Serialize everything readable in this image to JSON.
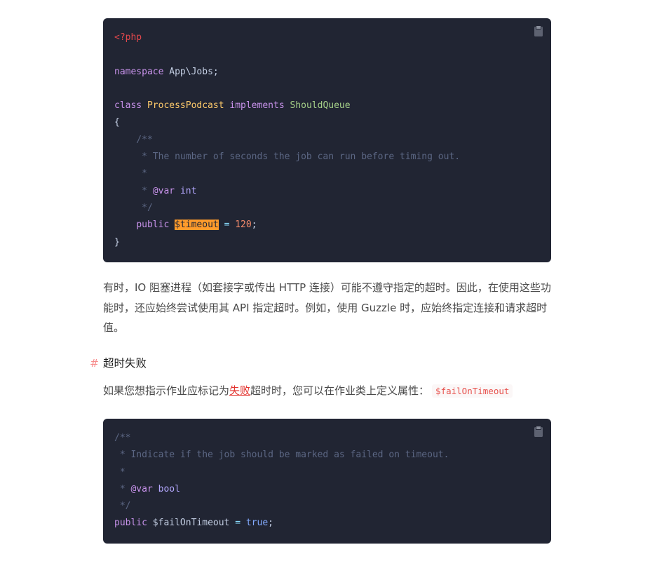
{
  "code_block_1": {
    "copy_icon": "clipboard-icon",
    "line_1": {
      "tag": "<?php"
    },
    "line_2": "",
    "line_3": {
      "keyword": "namespace",
      "name": " App\\Jobs;"
    },
    "line_4": "",
    "line_5": {
      "keyword": "class",
      "class_name": "ProcessPodcast",
      "implements": "implements",
      "interface": "ShouldQueue"
    },
    "line_6": {
      "text": "{"
    },
    "line_7": {
      "comment": "    /**"
    },
    "line_8": {
      "comment": "     * The number of seconds the job can run before timing out."
    },
    "line_9": {
      "comment": "     *"
    },
    "line_10": {
      "comment_prefix": "     * ",
      "doc_tag": "@var",
      "doc_type": "int"
    },
    "line_11": {
      "comment": "     */"
    },
    "line_12": {
      "indent": "    ",
      "keyword": "public",
      "variable": "$timeout",
      "operator": "=",
      "value": "120",
      "end": ";"
    },
    "line_13": {
      "text": "}"
    }
  },
  "paragraph_1": {
    "text": "有时，IO 阻塞进程（如套接字或传出 HTTP 连接）可能不遵守指定的超时。因此，在使用这些功能时，还应始终尝试使用其 API 指定超时。例如，使用 Guzzle 时，应始终指定连接和请求超时值。"
  },
  "heading": {
    "anchor": "#",
    "title": "超时失败"
  },
  "paragraph_2": {
    "text_before": "如果您想指示作业应标记为",
    "link_text": "失败",
    "text_after": "超时时，您可以在作业类上定义属性：",
    "inline_code": "$failOnTimeout"
  },
  "code_block_2": {
    "copy_icon": "clipboard-icon",
    "line_1": {
      "comment": "/**"
    },
    "line_2": {
      "comment": " * Indicate if the job should be marked as failed on timeout."
    },
    "line_3": {
      "comment": " *"
    },
    "line_4": {
      "comment_prefix": " * ",
      "doc_tag": "@var",
      "doc_type": "bool"
    },
    "line_5": {
      "comment": " */"
    },
    "line_6": {
      "keyword": "public",
      "variable": "$failOnTimeout",
      "operator": "=",
      "value": "true",
      "end": ";"
    }
  }
}
